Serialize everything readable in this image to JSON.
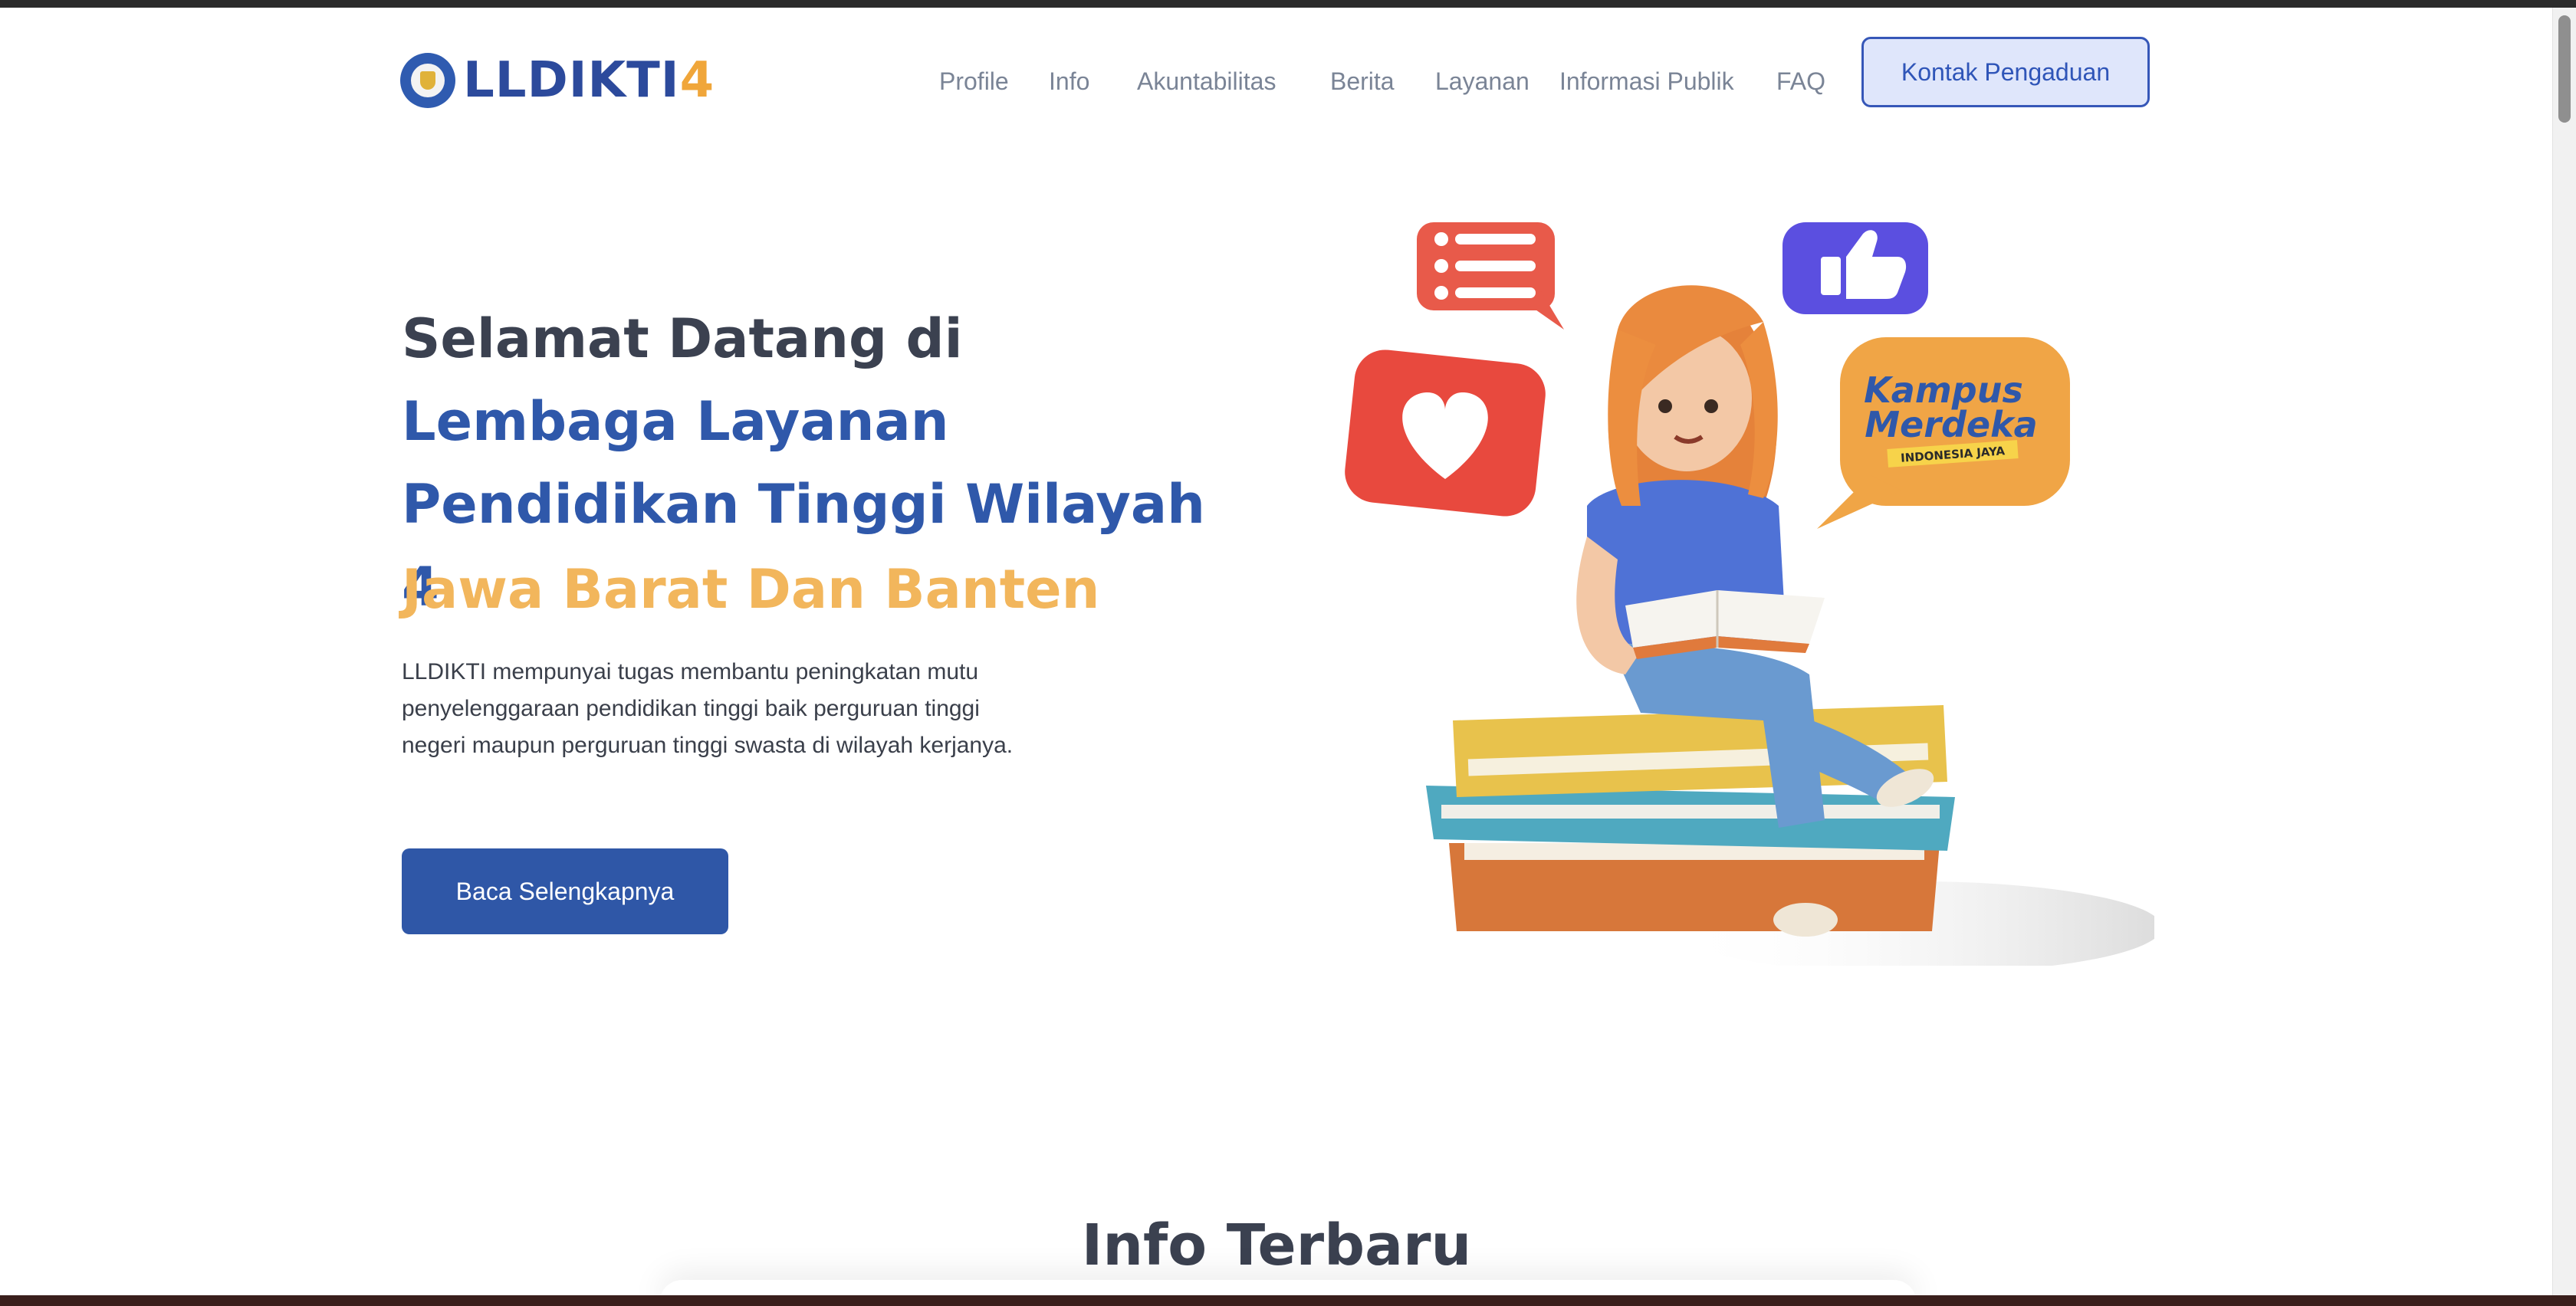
{
  "logo": {
    "text": "LLDIKTI",
    "accent": "4"
  },
  "nav": {
    "items": [
      {
        "label": "Profile"
      },
      {
        "label": "Info"
      },
      {
        "label": "Akuntabilitas"
      },
      {
        "label": "Berita"
      },
      {
        "label": "Layanan"
      },
      {
        "label": "Informasi Publik"
      },
      {
        "label": "FAQ"
      }
    ],
    "cta": "Kontak Pengaduan"
  },
  "hero": {
    "title_lead": "Selamat Datang di ",
    "title_highlight": "Lembaga Layanan Pendidikan Tinggi Wilayah 4",
    "subtitle": "Jawa Barat Dan Banten",
    "description": "LLDIKTI mempunyai tugas membantu peningkatan mutu penyelenggaraan pendidikan tinggi baik perguruan tinggi negeri maupun perguruan tinggi swasta di wilayah kerjanya.",
    "button": "Baca Selengkapnya",
    "illustration": {
      "bubble_line1": "Kampus",
      "bubble_line2": "Merdeka",
      "bubble_tagline": "INDONESIA JAYA"
    }
  },
  "info_section": {
    "title": "Info Terbaru"
  },
  "colors": {
    "primary": "#2f57a7",
    "accent": "#f2b65c",
    "text_dark": "#3b4150",
    "nav_text": "#7a8496",
    "cta_bg": "#dfe6fb"
  }
}
